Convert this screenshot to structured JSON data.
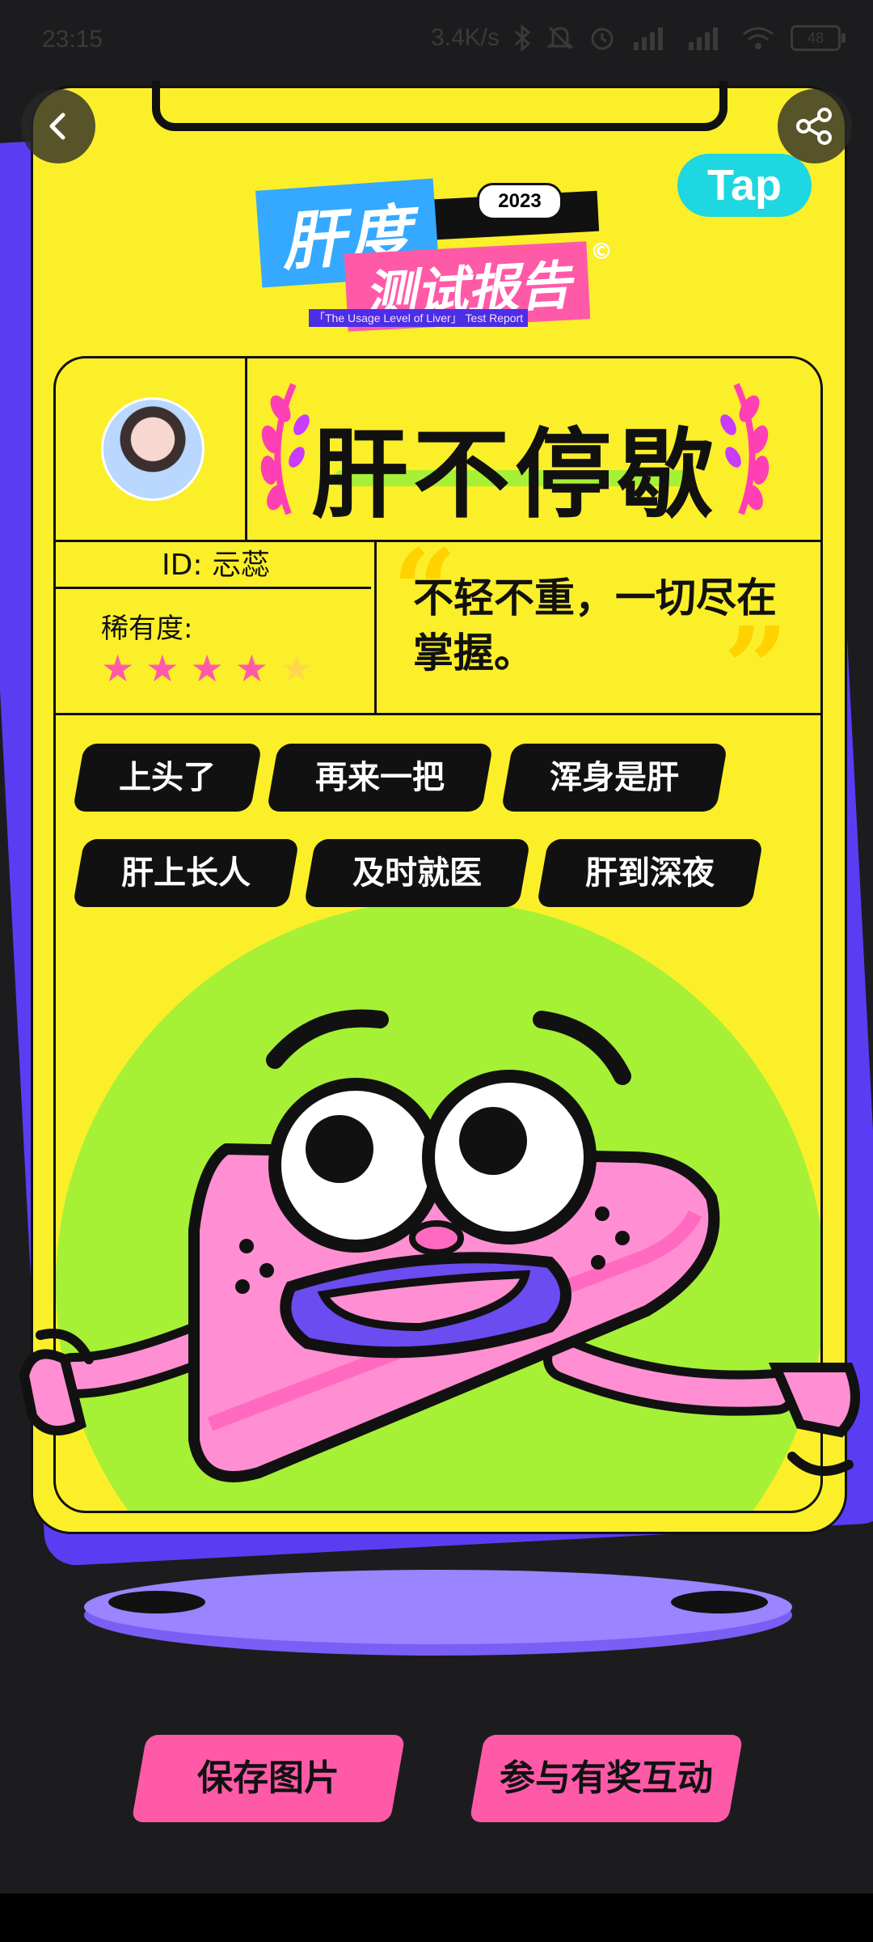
{
  "status_bar": {
    "time": "23:15",
    "speed": "3.4K/s",
    "icons": [
      "bluetooth-icon",
      "mute-icon",
      "alarm-icon",
      "hd-signal-icon",
      "signal-icon",
      "wifi-icon"
    ],
    "battery": "48"
  },
  "nav": {
    "back_icon": "chevron-left-icon",
    "share_icon": "share-icon"
  },
  "logo": {
    "text": "Tap"
  },
  "report": {
    "year": "2023",
    "title_line1": "肝度",
    "title_line2": "测试报告",
    "copyright": "©",
    "subtitle": "「The Usage Level of Liver」 Test Report"
  },
  "profile": {
    "badge_title": "肝不停歇",
    "id_label": "ID: 忈蕊",
    "rarity_label": "稀有度:",
    "rarity": {
      "filled": 4,
      "total": 5
    },
    "quote": "不轻不重，一切尽在掌握。"
  },
  "tags": [
    "上头了",
    "再来一把",
    "浑身是肝",
    "肝上长人",
    "及时就医",
    "肝到深夜"
  ],
  "actions": {
    "save": "保存图片",
    "join": "参与有奖互动"
  },
  "colors": {
    "card": "#fbef2a",
    "card_shadow": "#5a3df3",
    "accent_pink": "#ff5aa8",
    "accent_green": "#a6f036",
    "accent_cyan": "#1ed7e0"
  }
}
